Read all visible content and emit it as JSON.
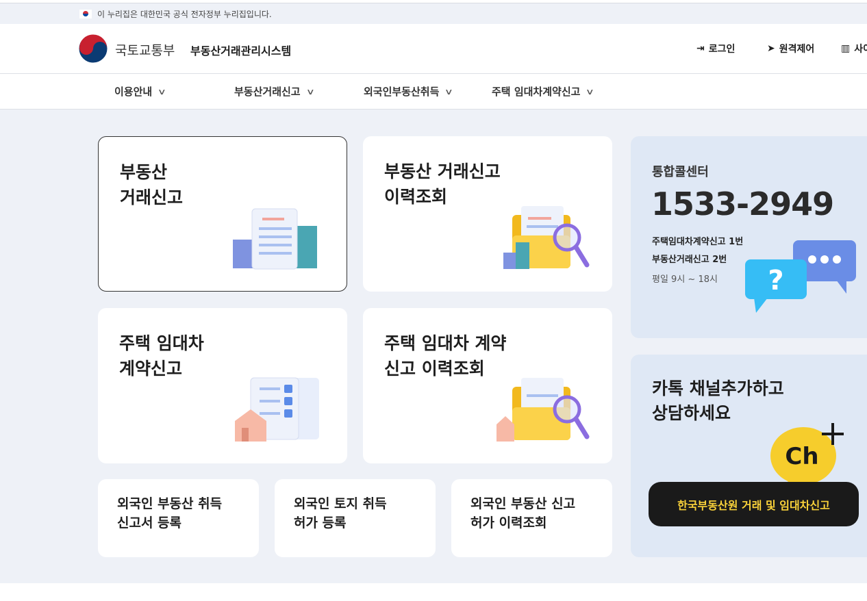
{
  "gov_banner": {
    "text": "이 누리집은 대한민국 공식 전자정부 누리집입니다."
  },
  "header": {
    "ministry": "국토교통부",
    "system": "부동산거래관리시스템",
    "utils": [
      {
        "label": "로그인",
        "icon": "login-icon"
      },
      {
        "label": "원격제어",
        "icon": "cursor-icon"
      },
      {
        "label": "사이트맵",
        "icon": "map-icon"
      }
    ]
  },
  "nav": [
    {
      "label": "이용안내"
    },
    {
      "label": "부동산거래신고"
    },
    {
      "label": "외국인부동산취득"
    },
    {
      "label": "주택 임대차계약신고"
    }
  ],
  "cards": [
    {
      "title": "부동산\n거래신고"
    },
    {
      "title": "부동산 거래신고\n이력조회"
    },
    {
      "title": "주택 임대차\n계약신고"
    },
    {
      "title": "주택 임대차 계약\n신고 이력조회"
    }
  ],
  "small_cards": [
    {
      "title": "외국인 부동산 취득\n신고서 등록"
    },
    {
      "title": "외국인 토지 취득\n허가 등록"
    },
    {
      "title": "외국인 부동산 신고\n허가 이력조회"
    }
  ],
  "callcenter": {
    "title": "통합콜센터",
    "number": "1533-2949",
    "line1": "주택임대차계약신고 1번",
    "line2": "부동산거래신고 2번",
    "hours": "평일 9시 ~ 18시"
  },
  "kakao": {
    "title": "카톡 채널추가하고\n상담하세요",
    "badge": "Ch",
    "button": "한국부동산원 거래 및 임대차신고"
  },
  "colors": {
    "bg": "#eef1f7",
    "panel": "#dfe8f5",
    "kakao_yellow": "#fbd33a"
  }
}
